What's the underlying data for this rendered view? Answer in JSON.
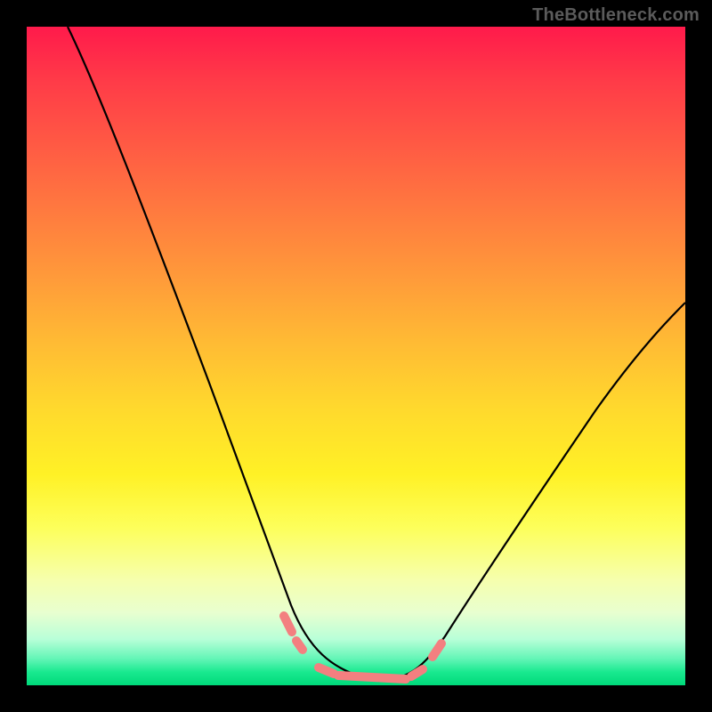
{
  "watermark": "TheBottleneck.com",
  "colors": {
    "top": "#ff1a4b",
    "mid": "#ffd92d",
    "bottom": "#00d97a",
    "curve": "#000000",
    "highlight": "#f37f80",
    "frame": "#000000"
  },
  "chart_data": {
    "type": "line",
    "title": "",
    "xlabel": "",
    "ylabel": "",
    "xlim": [
      0,
      100
    ],
    "ylim": [
      0,
      100
    ],
    "series": [
      {
        "name": "left-curve",
        "x": [
          10,
          13,
          16,
          19,
          22,
          25,
          28,
          31,
          34,
          36,
          38,
          40,
          41,
          42,
          44,
          46,
          48,
          50,
          52,
          54,
          56
        ],
        "y": [
          100,
          92,
          84,
          76,
          68,
          59,
          50,
          41,
          32,
          25,
          19,
          14,
          11,
          9,
          6,
          4,
          2.5,
          1.5,
          1,
          0.6,
          0.5
        ]
      },
      {
        "name": "right-curve",
        "x": [
          56,
          58,
          60,
          62,
          64,
          68,
          72,
          76,
          80,
          84,
          88,
          92,
          96,
          100
        ],
        "y": [
          0.5,
          1,
          1.8,
          3,
          5,
          10,
          16,
          23,
          30,
          37,
          43,
          49,
          54,
          58
        ]
      },
      {
        "name": "highlight-dots",
        "x": [
          40,
          41.5,
          46,
          49,
          51,
          53,
          55,
          57,
          60,
          61.5
        ],
        "y": [
          11,
          9.5,
          3.5,
          2,
          1.5,
          1.2,
          1,
          0.9,
          3,
          5
        ]
      }
    ],
    "annotations": [
      {
        "text": "TheBottleneck.com",
        "position": "top-right"
      }
    ]
  }
}
